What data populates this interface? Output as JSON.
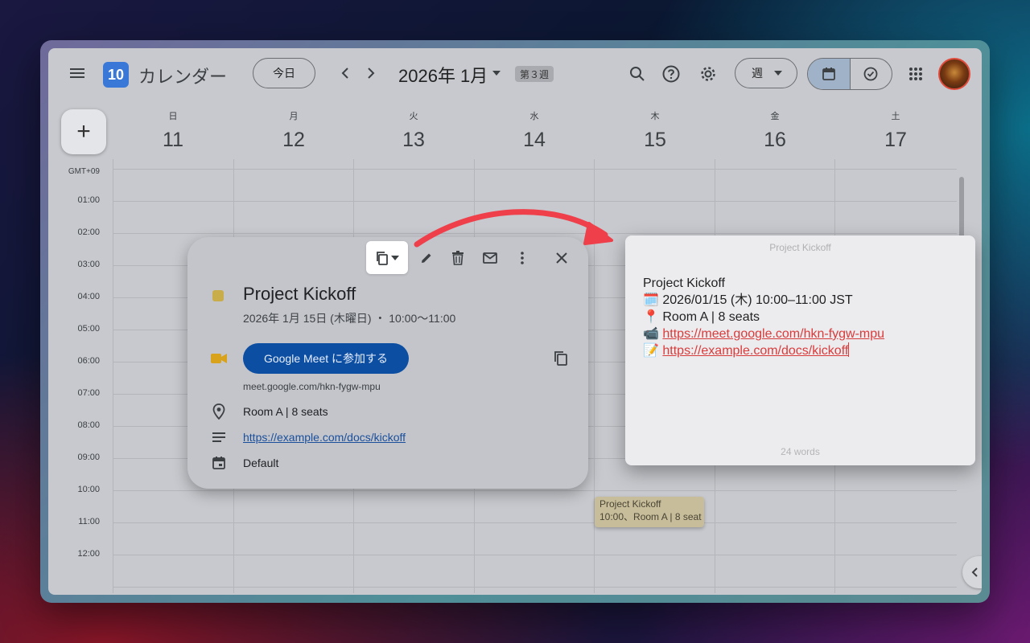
{
  "header": {
    "app_logo_text": "10",
    "app_title": "カレンダー",
    "today_label": "今日",
    "month_label": "2026年 1月",
    "week_badge": "第３週",
    "view_select_label": "週"
  },
  "days": [
    {
      "dow": "日",
      "num": "11"
    },
    {
      "dow": "月",
      "num": "12"
    },
    {
      "dow": "火",
      "num": "13"
    },
    {
      "dow": "水",
      "num": "14"
    },
    {
      "dow": "木",
      "num": "15"
    },
    {
      "dow": "金",
      "num": "16"
    },
    {
      "dow": "土",
      "num": "17"
    }
  ],
  "times": [
    "GMT+09",
    "01:00",
    "02:00",
    "03:00",
    "04:00",
    "05:00",
    "06:00",
    "07:00",
    "08:00",
    "09:00",
    "10:00",
    "11:00",
    "12:00"
  ],
  "event_chip": {
    "title": "Project Kickoff",
    "detail": "10:00、Room A | 8 seat"
  },
  "popup": {
    "title": "Project Kickoff",
    "date": "2026年 1月 15日 (木曜日) ・ 10:00～11:00",
    "meet_button": "Google Meet に参加する",
    "meet_url": "meet.google.com/hkn-fygw-mpu",
    "location": "Room A | 8 seats",
    "description_link": "https://example.com/docs/kickoff",
    "calendar": "Default"
  },
  "note": {
    "window_title": "Project Kickoff",
    "line1": "Project Kickoff",
    "line2_icon": "🗓️",
    "line2": "2026/01/15 (木) 10:00–11:00 JST",
    "line3_icon": "📍",
    "line3": "Room A | 8 seats",
    "line4_icon": "📹",
    "line4": "https://meet.google.com/hkn-fygw-mpu",
    "line5_icon": "📝",
    "line5": "https://example.com/docs/kickoff",
    "footer": "24 words"
  },
  "colors": {
    "accent_blue": "#0b4ea2",
    "event_yellow": "#c9ad4a",
    "arrow_red": "#ef3f4a",
    "link_red": "#d93b3b"
  }
}
